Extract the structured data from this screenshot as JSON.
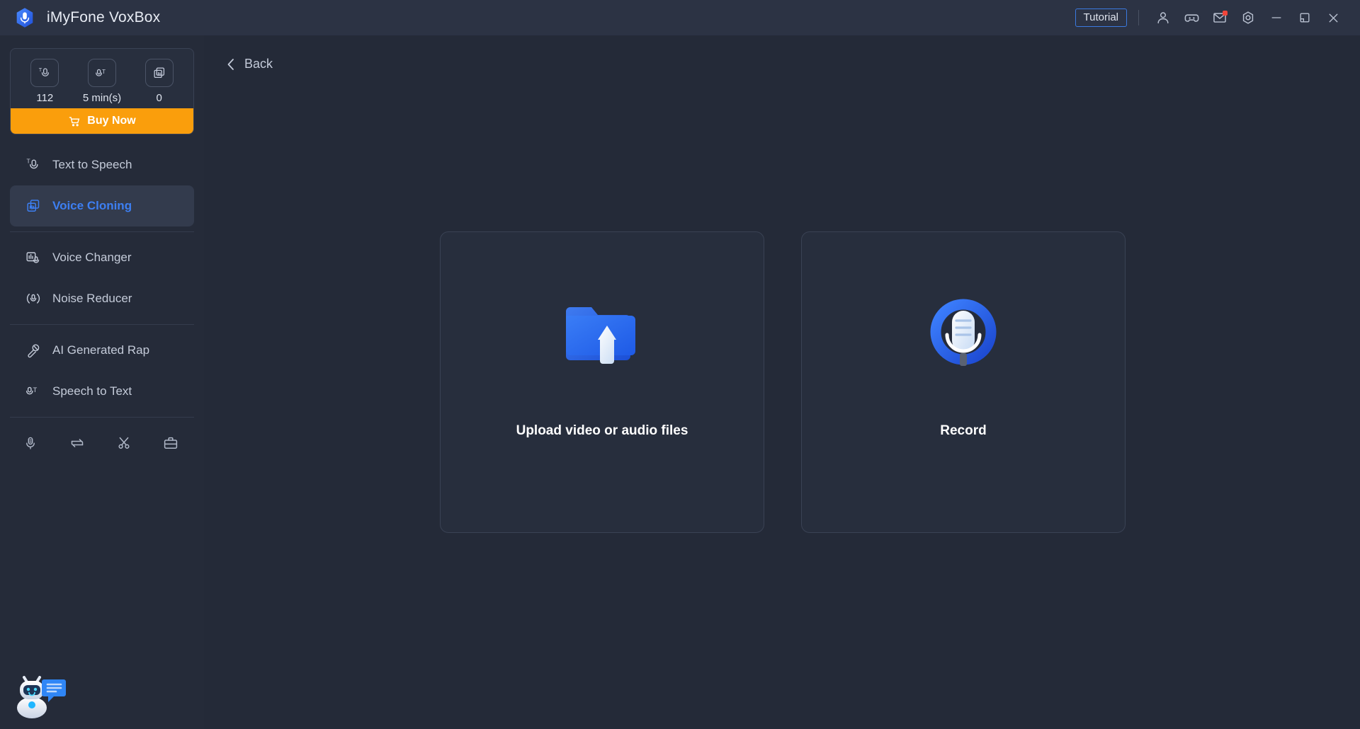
{
  "window": {
    "app_title": "iMyFone VoxBox",
    "logo_icon": "voxbox-microphone-hexagon-logo",
    "accent_color": "#3d7ff2",
    "buy_color": "#fa9e0c",
    "background_color": "#242a38",
    "sidebar_color": "#252b39",
    "titlebar_color": "#2c3344"
  },
  "titlebar": {
    "tutorial_label": "Tutorial",
    "icons": [
      {
        "name": "account-icon",
        "glyph": "user"
      },
      {
        "name": "discord-icon",
        "glyph": "gamepad"
      },
      {
        "name": "mail-icon",
        "glyph": "envelope",
        "badge": true
      },
      {
        "name": "settings-icon",
        "glyph": "gear"
      },
      {
        "name": "minimize-button",
        "glyph": "minimize"
      },
      {
        "name": "maximize-button",
        "glyph": "restore"
      },
      {
        "name": "close-button",
        "glyph": "close"
      }
    ]
  },
  "sidebar": {
    "credits": {
      "items": [
        {
          "icon": "text-to-speech-credit-icon",
          "value": "112"
        },
        {
          "icon": "speech-to-text-credit-icon",
          "value": "5 min(s)"
        },
        {
          "icon": "voice-cloning-credit-icon",
          "value": "0"
        }
      ],
      "buy_label": "Buy Now",
      "cart_icon": "shopping-cart-icon"
    },
    "items": [
      {
        "label": "Text to Speech",
        "icon": "text-to-speech-icon",
        "active": false
      },
      {
        "label": "Voice Cloning",
        "icon": "voice-cloning-icon",
        "active": true
      },
      {
        "label": "Voice Changer",
        "icon": "voice-changer-icon",
        "active": false
      },
      {
        "label": "Noise Reducer",
        "icon": "noise-reducer-icon",
        "active": false
      },
      {
        "label": "AI Generated Rap",
        "icon": "ai-rap-icon",
        "active": false
      },
      {
        "label": "Speech to Text",
        "icon": "speech-to-text-icon",
        "active": false
      }
    ],
    "tools": [
      {
        "name": "audio-recorder-tool-icon"
      },
      {
        "name": "audio-converter-tool-icon"
      },
      {
        "name": "audio-cutter-tool-icon"
      },
      {
        "name": "toolbox-tool-icon"
      }
    ],
    "assistant_icon": "chat-assistant-bot-icon"
  },
  "main": {
    "back_label": "Back",
    "back_icon": "chevron-left-icon",
    "cards": [
      {
        "label": "Upload video or audio files",
        "icon": "upload-folder-icon"
      },
      {
        "label": "Record",
        "icon": "microphone-record-icon"
      }
    ]
  }
}
